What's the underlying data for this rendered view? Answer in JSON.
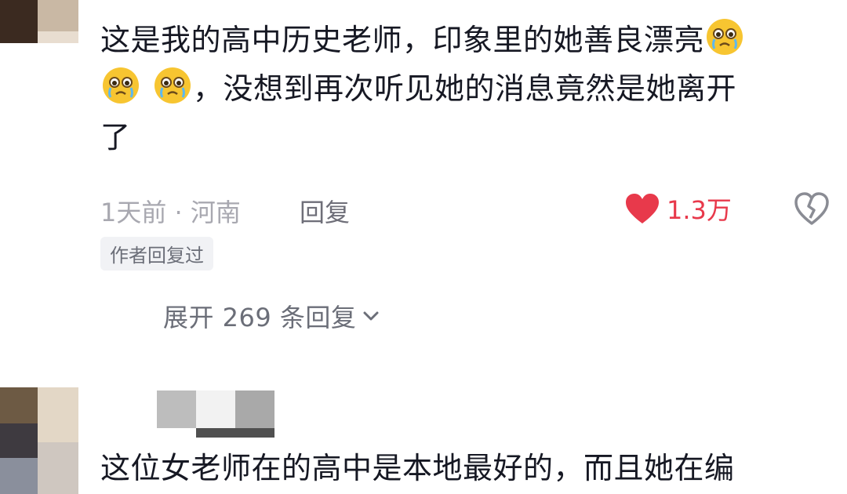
{
  "comment1": {
    "text_line1": "这是我的高中历史老师，印象里的她善良漂亮",
    "text_line2": "，没想到再次听见她的消息竟然是她离开",
    "text_line3": "了",
    "time_location": "1天前 · 河南",
    "reply_label": "回复",
    "like_count": "1.3万",
    "author_replied_badge": "作者回复过",
    "expand_replies": "展开 269 条回复"
  },
  "comment2": {
    "text": "这位女老师在的高中是本地最好的，而且她在编"
  },
  "colors": {
    "like_red": "#e8394b",
    "meta_gray": "#a8a8b0",
    "text_dark": "#161823"
  },
  "icons": [
    "crying-emoji-icon",
    "heart-icon",
    "broken-heart-icon",
    "chevron-down-icon"
  ]
}
